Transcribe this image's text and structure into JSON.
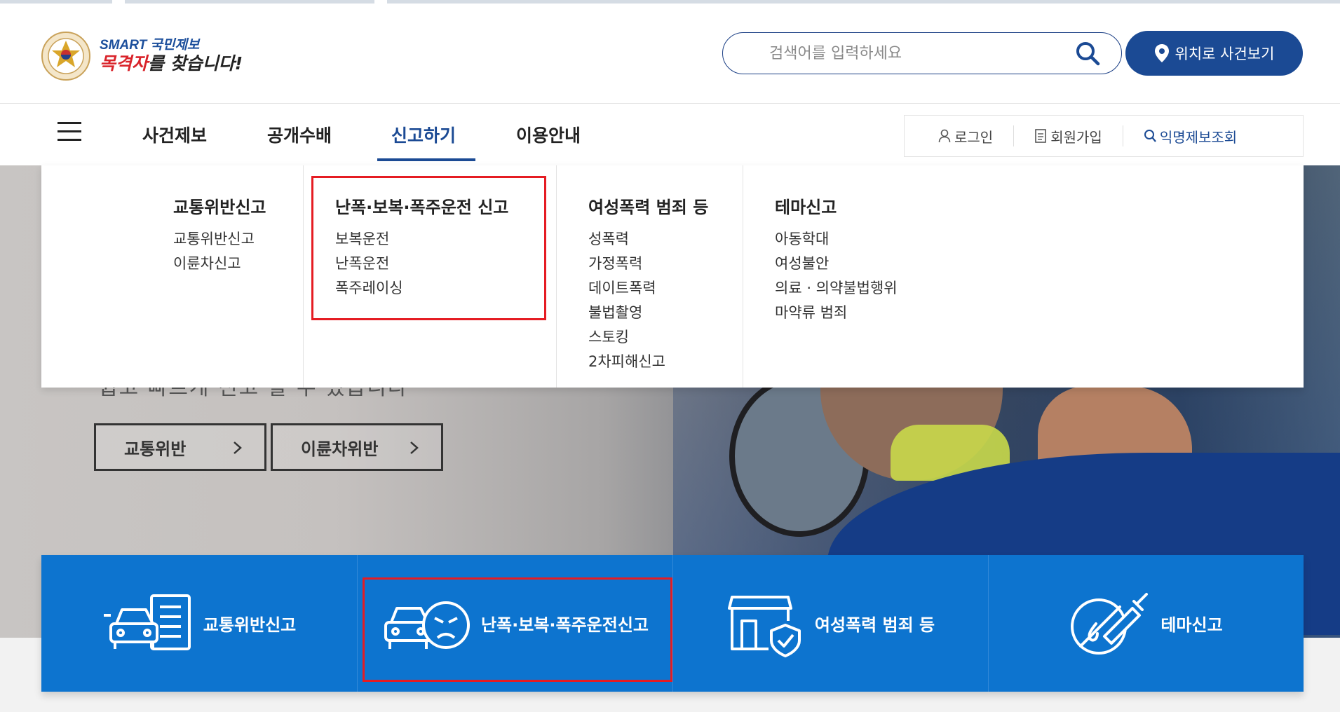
{
  "header": {
    "logo_small": "SMART 국민제보",
    "logo_main_red": "목격자",
    "logo_main_rest": "를 찾습니다!",
    "search_placeholder": "검색어를 입력하세요",
    "location_button": "위치로 사건보기"
  },
  "nav": {
    "menu": [
      "사건제보",
      "공개수배",
      "신고하기",
      "이용안내"
    ],
    "active_menu": "신고하기",
    "util": {
      "login": "로그인",
      "signup": "회원가입",
      "anonymous_lookup": "익명제보조회"
    }
  },
  "dropdown": {
    "columns": [
      {
        "title": "교통위반신고",
        "items": [
          "교통위반신고",
          "이륜차신고"
        ]
      },
      {
        "title": "난폭·보복·폭주운전 신고",
        "items": [
          "보복운전",
          "난폭운전",
          "폭주레이싱"
        ],
        "highlighted": true
      },
      {
        "title": "여성폭력 범죄 등",
        "items": [
          "성폭력",
          "가정폭력",
          "데이트폭력",
          "불법촬영",
          "스토킹",
          "2차피해신고"
        ]
      },
      {
        "title": "테마신고",
        "items": [
          "아동학대",
          "여성불안",
          "의료 · 의약불법행위",
          "마약류 범죄"
        ]
      }
    ]
  },
  "hero": {
    "subtitle": "쉽고 빠르게 신고 할 수 있습니다",
    "buttons": [
      "교통위반",
      "이륜차위반"
    ]
  },
  "quick_menu": [
    {
      "label": "교통위반신고",
      "icon": "car-document-icon"
    },
    {
      "label": "난폭·보복·폭주운전신고",
      "icon": "car-angry-face-icon",
      "highlighted": true
    },
    {
      "label": "여성폭력 범죄 등",
      "icon": "store-shield-icon"
    },
    {
      "label": "테마신고",
      "icon": "syringe-prohibited-icon"
    }
  ],
  "colors": {
    "primary_navy": "#1b4a94",
    "quick_blue": "#0d74cf",
    "highlight_red": "#e51c23",
    "logo_red": "#d9232a"
  }
}
